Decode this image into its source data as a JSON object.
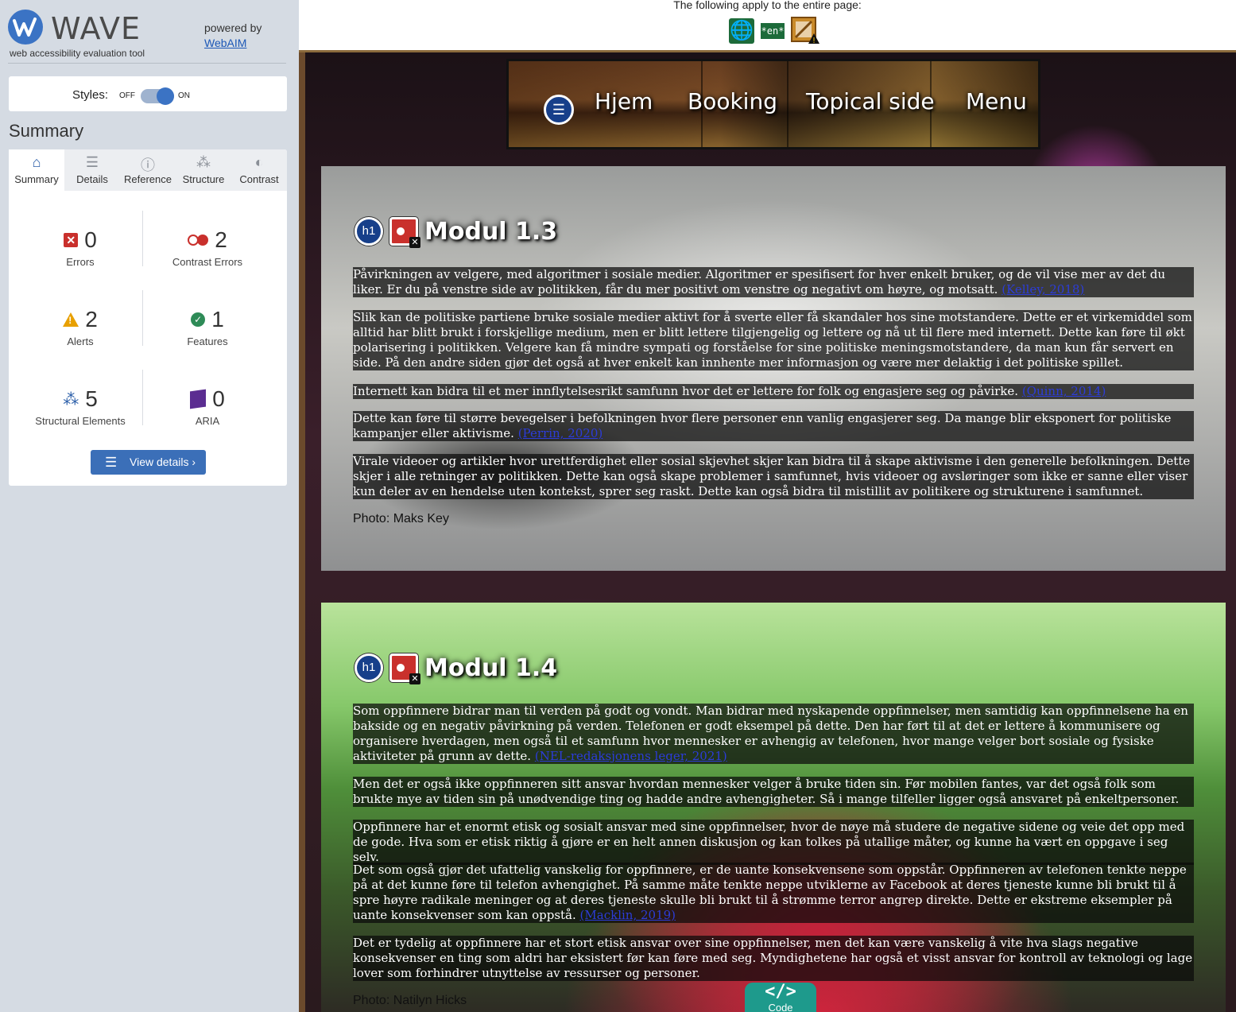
{
  "wave": {
    "logo_text": "WAVE",
    "tagline": "web accessibility evaluation tool",
    "powered_by": "powered by",
    "webaim_link": "WebAIM",
    "styles_label": "Styles:",
    "toggle_off": "OFF",
    "toggle_on": "ON",
    "summary_heading": "Summary",
    "tabs": [
      {
        "label": "Summary",
        "icon": "home-icon"
      },
      {
        "label": "Details",
        "icon": "list-icon"
      },
      {
        "label": "Reference",
        "icon": "info-icon"
      },
      {
        "label": "Structure",
        "icon": "hierarchy-icon"
      },
      {
        "label": "Contrast",
        "icon": "contrast-icon"
      }
    ],
    "active_tab": "Summary",
    "stats": {
      "errors": {
        "count": "0",
        "label": "Errors"
      },
      "contrast_errors": {
        "count": "2",
        "label": "Contrast Errors"
      },
      "alerts": {
        "count": "2",
        "label": "Alerts"
      },
      "features": {
        "count": "1",
        "label": "Features"
      },
      "structural": {
        "count": "5",
        "label": "Structural Elements"
      },
      "aria": {
        "count": "0",
        "label": "ARIA"
      }
    },
    "view_details": "View details ›",
    "colors": {
      "accent": "#3b73c4",
      "error": "#c9302c",
      "alert": "#e8a000",
      "feature": "#2e8b57",
      "aria": "#5b2d91"
    }
  },
  "topstrip": {
    "text": "The following apply to the entire page:",
    "lang_badge": "*en*"
  },
  "site": {
    "nav": [
      "Hjem",
      "Booking",
      "Topical side",
      "Menu"
    ],
    "sections": [
      {
        "title": "Modul 1.3",
        "badge": "h1",
        "paragraphs": [
          {
            "text": "Påvirkningen av velgere, med algoritmer i sosiale medier. Algoritmer er spesifisert for hver enkelt bruker, og de vil vise mer av det du liker. Er du på venstre side av politikken, får du mer positivt om venstre og negativt om høyre, og motsatt.",
            "cite": "(Kelley, 2018)"
          },
          {
            "text": "Slik kan de politiske partiene bruke sosiale medier aktivt for å sverte eller få skandaler hos sine motstandere. Dette er et virkemiddel som alltid har blitt brukt i forskjellige medium, men er blitt lettere tilgjengelig og lettere og nå ut til flere med internett. Dette kan føre til økt polarisering i politikken. Velgere kan få mindre sympati og forståelse for sine politiske meningsmotstandere, da man kun får servert en side. På den andre siden gjør det også at hver enkelt kan innhente mer informasjon og være mer delaktig i det politiske spillet.",
            "cite": ""
          },
          {
            "text": "Internett kan bidra til et mer innflytelsesrikt samfunn hvor det er lettere for folk og engasjere seg og påvirke.",
            "cite": "(Quinn, 2014)"
          },
          {
            "text": "Dette kan føre til større bevegelser i befolkningen hvor flere personer enn vanlig engasjerer seg. Da mange blir eksponert for politiske kampanjer eller aktivisme.",
            "cite": "(Perrin, 2020)"
          },
          {
            "text": "Virale videoer og artikler hvor urettferdighet eller sosial skjevhet skjer kan bidra til å skape aktivisme i den generelle befolkningen. Dette skjer i alle retninger av politikken. Dette kan også skape problemer i samfunnet, hvis videoer og avsløringer som ikke er sanne eller viser kun deler av en hendelse uten kontekst, sprer seg raskt. Dette kan også bidra til mistillit av politikere og strukturene i samfunnet.",
            "cite": ""
          }
        ],
        "photo": "Photo: Maks Key"
      },
      {
        "title": "Modul 1.4",
        "badge": "h1",
        "paragraphs": [
          {
            "text": "Som oppfinnere bidrar man til verden på godt og vondt. Man bidrar med nyskapende oppfinnelser, men samtidig kan oppfinnelsene ha en bakside og en negativ påvirkning på verden. Telefonen er godt eksempel på dette. Den har ført til at det er lettere å kommunisere og organisere hverdagen, men også til et samfunn hvor mennesker er avhengig av telefonen, hvor mange velger bort sosiale og fysiske aktiviteter på grunn av dette.",
            "cite": "(NEL-redaksjonens leger, 2021)"
          },
          {
            "text": "Men det er også ikke oppfinneren sitt ansvar hvordan mennesker velger å bruke tiden sin. Før mobilen fantes, var det også folk som brukte mye av tiden sin på unødvendige ting og hadde andre avhengigheter. Så i mange tilfeller ligger også ansvaret på enkeltpersoner.",
            "cite": ""
          },
          {
            "text": "Oppfinnere har et enormt etisk og sosialt ansvar med sine oppfinnelser, hvor de nøye må studere de negative sidene og veie det opp med de gode. Hva som er etisk riktig å gjøre er en helt annen diskusjon og kan tolkes på utallige måter, og kunne ha vært en oppgave i seg selv.",
            "cite": ""
          },
          {
            "text": "Det som også gjør det ufattelig vanskelig for oppfinnere, er de uante konsekvensene som oppstår. Oppfinneren av telefonen tenkte neppe på at det kunne føre til telefon avhengighet. På samme måte tenkte neppe utviklerne av Facebook at deres tjeneste kunne bli brukt til å spre høyre radikale meninger og at deres tjeneste skulle bli brukt til å strømme terror angrep direkte. Dette er ekstreme eksempler på uante konsekvenser som kan oppstå.",
            "cite": "(Macklin, 2019)"
          },
          {
            "text": "Det er tydelig at oppfinnere har et stort etisk ansvar over sine oppfinnelser, men det kan være vanskelig å vite hva slags negative konsekvenser en ting som aldri har eksistert før kan føre med seg. Myndighetene har også et visst ansvar for kontroll av teknologi og lage lover som forhindrer utnyttelse av ressurser og personer.",
            "cite": ""
          }
        ],
        "photo": "Photo: Natilyn Hicks"
      }
    ]
  },
  "code_tab": {
    "icon": "</>",
    "label": "Code"
  }
}
